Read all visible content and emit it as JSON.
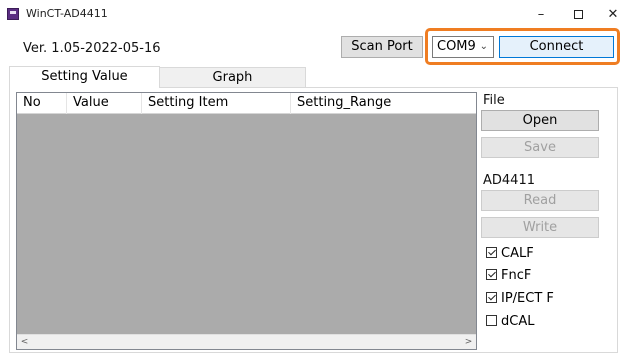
{
  "window": {
    "title": "WinCT-AD4411",
    "minimize_glyph": "–",
    "close_glyph": "✕"
  },
  "version_label": "Ver. 1.05-2022-05-16",
  "toolbar": {
    "scan_port_label": "Scan Port",
    "port_selected": "COM9",
    "connect_label": "Connect",
    "highlight_color": "#ef7d22"
  },
  "tabs": [
    {
      "label": "Setting Value",
      "active": true
    },
    {
      "label": "Graph",
      "active": false
    }
  ],
  "grid": {
    "columns": [
      "No",
      "Value",
      "Setting Item",
      "Setting_Range"
    ],
    "rows": [],
    "scroll_left": "<",
    "scroll_right": ">"
  },
  "side_panel": {
    "file_label": "File",
    "open_label": "Open",
    "save_label": "Save",
    "device_label": "AD4411",
    "read_label": "Read",
    "write_label": "Write",
    "checkboxes": [
      {
        "label": "CALF",
        "checked": true
      },
      {
        "label": "FncF",
        "checked": true
      },
      {
        "label": "IP/ECT F",
        "checked": true
      },
      {
        "label": "dCAL",
        "checked": false
      }
    ]
  }
}
